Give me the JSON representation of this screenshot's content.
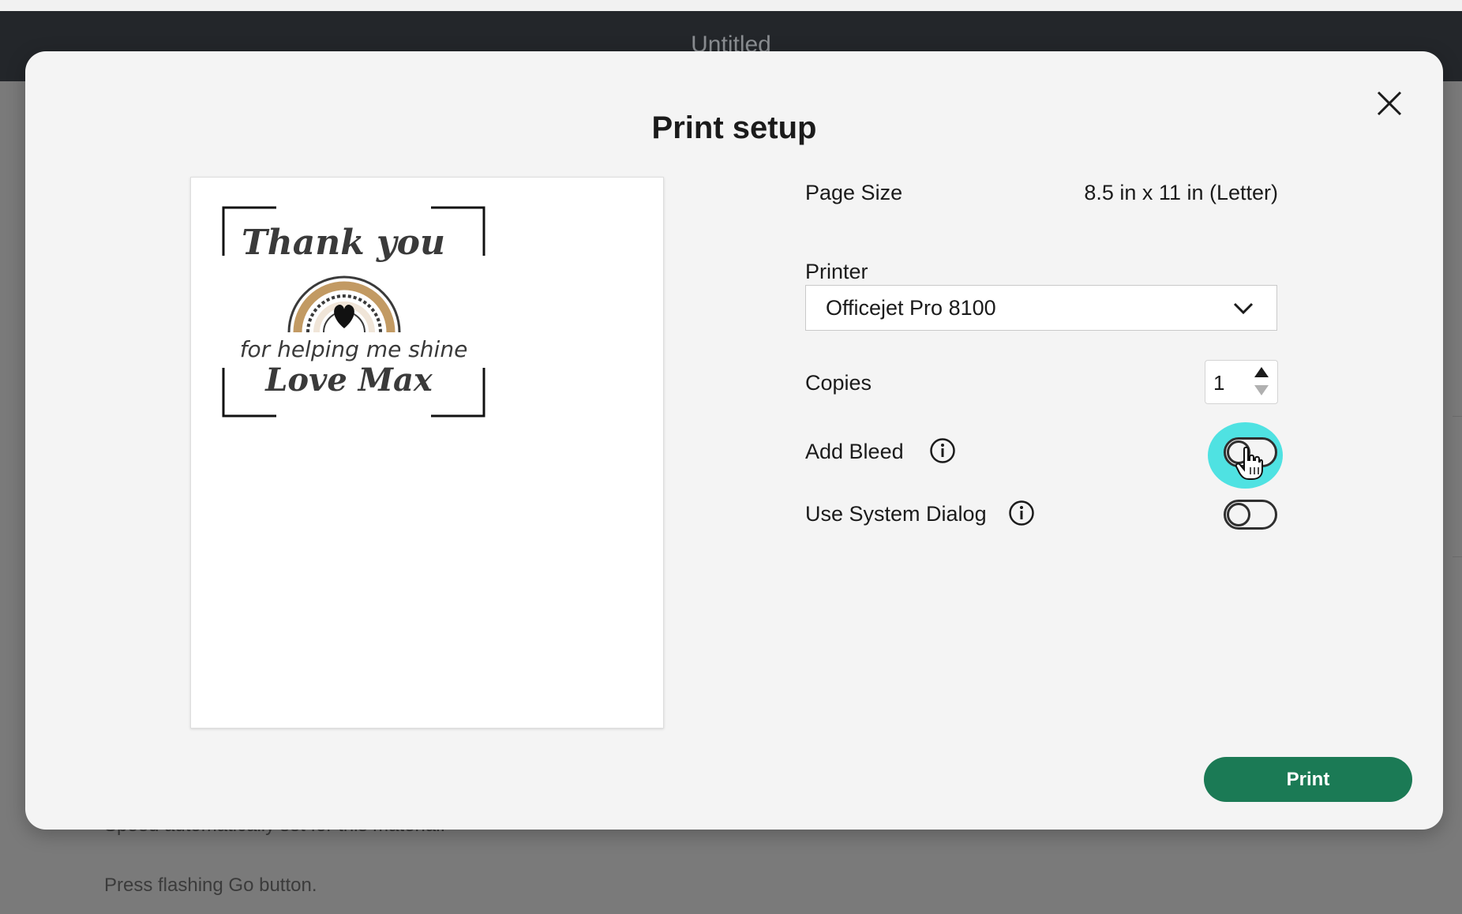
{
  "app": {
    "document_title": "Untitled"
  },
  "background": {
    "status_line_1": "Speed automatically set for this material.",
    "status_line_2": "Press flashing Go button."
  },
  "dialog": {
    "title": "Print setup",
    "close_icon": "close-icon",
    "page_size": {
      "label": "Page Size",
      "value": "8.5 in x 11 in (Letter)"
    },
    "printer": {
      "label": "Printer",
      "selected": "Officejet Pro 8100",
      "icon": "chevron-down-icon"
    },
    "copies": {
      "label": "Copies",
      "value": "1"
    },
    "add_bleed": {
      "label": "Add Bleed",
      "info_icon": "info-icon",
      "state": "off"
    },
    "use_system_dialog": {
      "label": "Use System Dialog",
      "info_icon": "info-icon",
      "state": "off"
    },
    "print_button": "Print"
  },
  "preview": {
    "line1": "Thank you",
    "line2": "for helping me shine",
    "line3": "Love Max"
  },
  "colors": {
    "primary_button": "#1b7a55",
    "highlight": "#4fe2e2",
    "titlebar": "#23262a",
    "rainbow_tan": "#c29a63"
  }
}
